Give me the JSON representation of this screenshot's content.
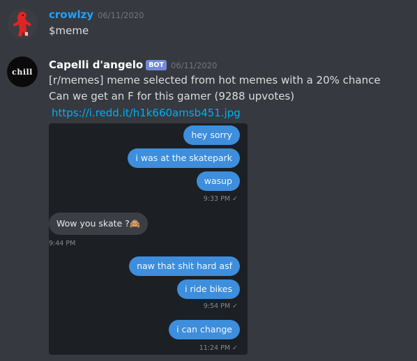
{
  "messages": [
    {
      "username": "crowlzy",
      "timestamp": "06/11/2020",
      "text": "$meme"
    },
    {
      "username": "Capelli d'angelo",
      "bot_tag": "BOT",
      "timestamp": "06/11/2020",
      "avatar_text": "chill",
      "lines": [
        "[r/memes] meme selected from hot memes with a 20% chance",
        "Can we get an F for this gamer (9288 upvotes)"
      ],
      "link": "https://i.redd.it/h1k660amsb451.jpg",
      "embed": {
        "bubbles": [
          "hey sorry",
          "i was at the skatepark",
          "wasup",
          "Wow you skate ?🙈",
          "naw that shit hard asf",
          "i ride bikes",
          "i can change"
        ],
        "timestamps": [
          "9:33 PM ✓",
          "9:44 PM",
          "9:54 PM ✓",
          "11:24 PM ✓"
        ]
      }
    }
  ],
  "colors": {
    "background": "#36393f",
    "username_1": "#1fa1ff",
    "link": "#00aff4",
    "bot_badge": "#7289da",
    "outgoing_bubble": "#3d8edc",
    "incoming_bubble": "#3b3f45"
  }
}
